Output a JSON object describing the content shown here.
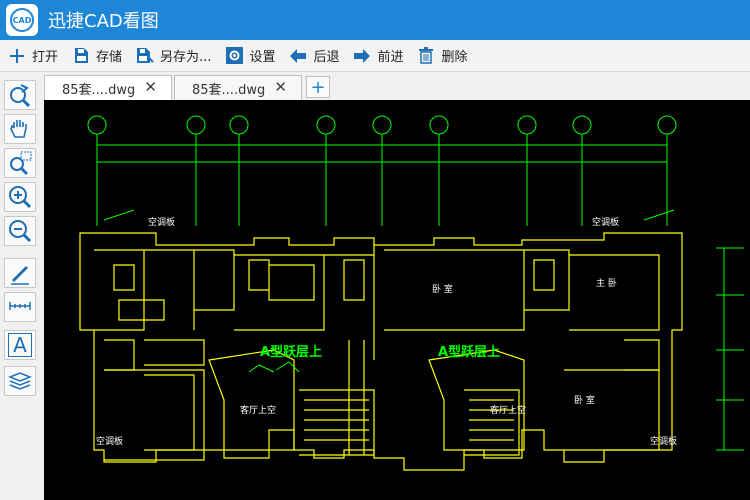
{
  "app": {
    "title": "迅捷CAD看图",
    "logo_text": "CAD"
  },
  "toolbar": {
    "buttons": [
      {
        "label": "打开",
        "icon": "plus-icon"
      },
      {
        "label": "存储",
        "icon": "save-icon"
      },
      {
        "label": "另存为...",
        "icon": "save-as-icon"
      },
      {
        "label": "设置",
        "icon": "gear-icon"
      },
      {
        "label": "后退",
        "icon": "arrow-left-icon"
      },
      {
        "label": "前进",
        "icon": "arrow-right-icon"
      },
      {
        "label": "删除",
        "icon": "trash-icon"
      }
    ]
  },
  "tabs": [
    {
      "label": "85套....dwg",
      "close": "✕",
      "active": true
    },
    {
      "label": "85套....dwg",
      "close": "✕",
      "active": false
    }
  ],
  "tab_add": "+",
  "side_tools": [
    "zoom-back-icon",
    "pan-hand-icon",
    "zoom-window-icon",
    "zoom-in-icon",
    "zoom-out-icon",
    "pencil-icon",
    "measure-icon",
    "text-tool-icon",
    "layers-icon"
  ],
  "side_text_tool_glyph": "A",
  "drawing": {
    "room_labels": {
      "ac_board": "空调板",
      "bedroom": "卧 室",
      "master_bedroom": "主 卧",
      "living_open": "客厅上空",
      "duplex_up": "A型跃层上"
    },
    "colors": {
      "walls": "#ffff00",
      "grid": "#00ff00",
      "labels": "#ffffff",
      "highlight": "#00ff00"
    }
  }
}
